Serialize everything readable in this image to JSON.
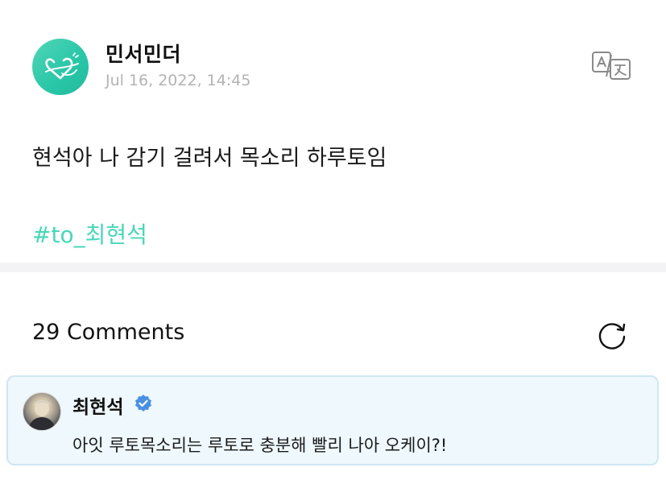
{
  "post": {
    "author": "민서민더",
    "date": "Jul 16, 2022, 14:45",
    "text": "현석아 나 감기 걸려서 목소리 하루토임",
    "hashtag": "#to_최현석"
  },
  "comments": {
    "count_label": "29 Comments",
    "pinned": {
      "author": "최현석",
      "text": "아잇 루토목소리는 루토로 충분해 빨리 나아 오케이?!"
    }
  },
  "colors": {
    "accent": "#47d7b7",
    "verified": "#4a90e2",
    "comment_bg": "#eef8fd",
    "date_gray": "#b3b3b3"
  },
  "icons": {
    "translate": "translate-icon",
    "refresh": "refresh-icon",
    "verified": "verified-badge-icon"
  }
}
